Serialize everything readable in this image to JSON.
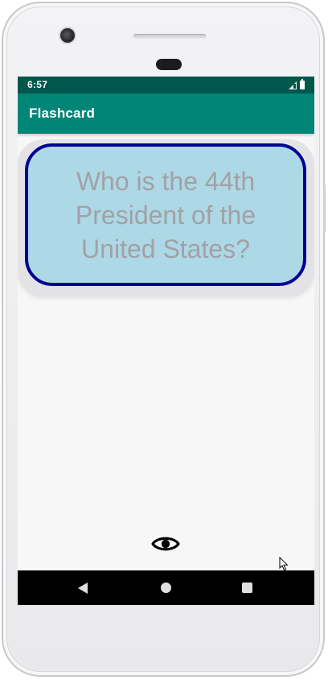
{
  "status_bar": {
    "time": "6:57",
    "icons": [
      "signal-icon",
      "battery-icon"
    ]
  },
  "app_bar": {
    "title": "Flashcard"
  },
  "flashcard": {
    "question": "Who is the 44th President of the United States?"
  },
  "toggle_answer": {
    "icon": "eye-icon"
  },
  "nav_bar": {
    "icons": [
      "back-icon",
      "home-icon",
      "recents-icon"
    ]
  },
  "colors": {
    "status_bar": "#00574b",
    "app_bar": "#008577",
    "card_background": "#add8e6",
    "card_border": "#000093",
    "question_text": "#a1a1a6",
    "screen_background": "#f7f7f8",
    "nav_bar": "#000000"
  }
}
